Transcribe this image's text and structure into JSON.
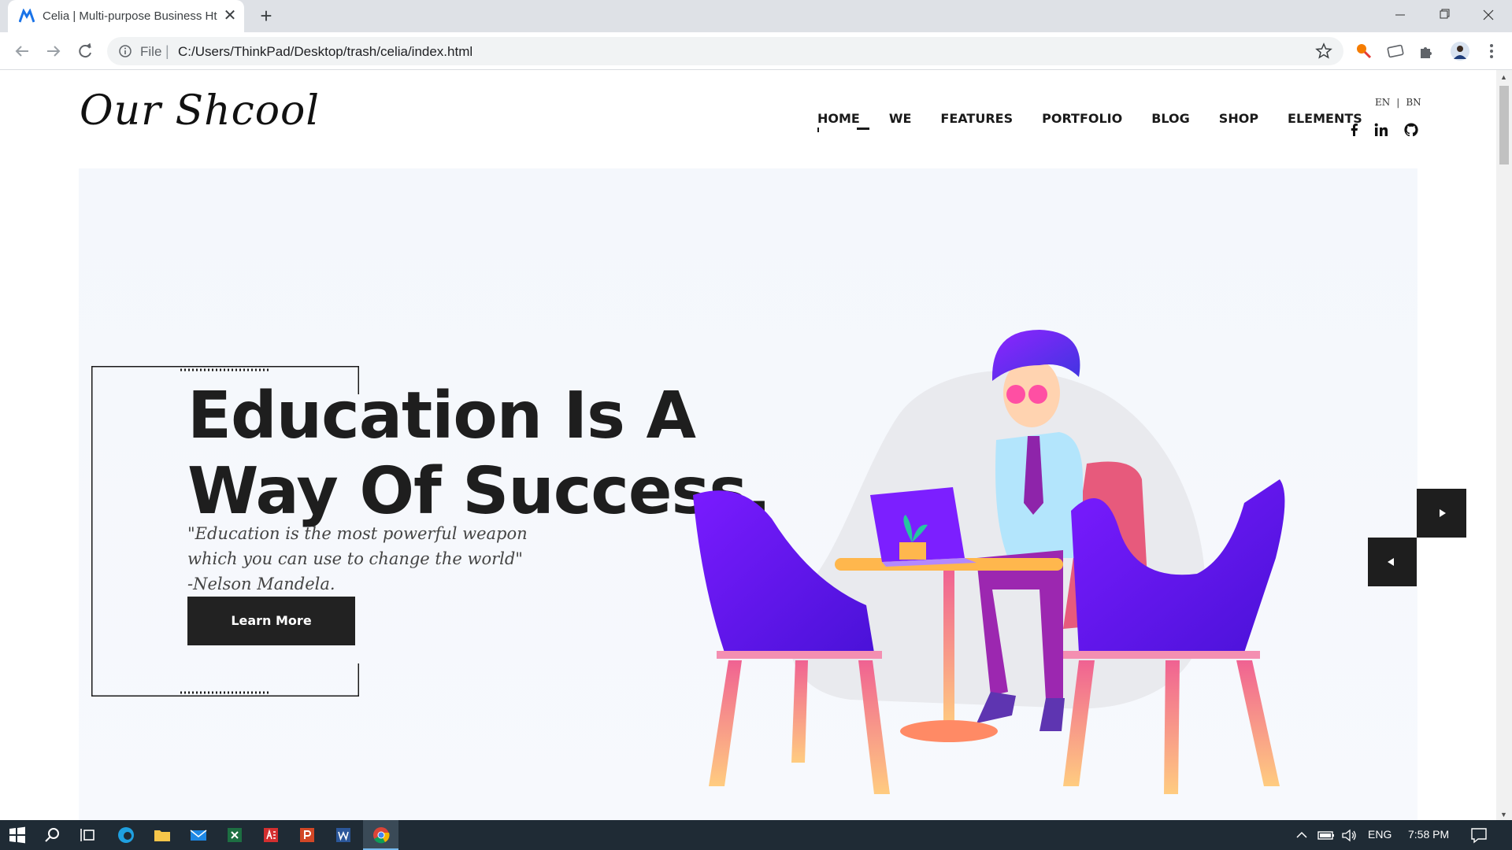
{
  "browser": {
    "tab_title": "Celia | Multi-purpose Business Ht",
    "url_scheme": "File",
    "url": "C:/Users/ThinkPad/Desktop/trash/celia/index.html"
  },
  "site": {
    "logo": "Our Shcool",
    "menu": [
      "HOME",
      "WE",
      "FEATURES",
      "PORTFOLIO",
      "BLOG",
      "SHOP",
      "ELEMENTS"
    ],
    "lang": {
      "en": "EN",
      "sep": "|",
      "bn": "BN"
    },
    "social_icons": [
      "facebook-icon",
      "linkedin-icon",
      "github-icon"
    ]
  },
  "hero": {
    "heading_line1": "Education Is A",
    "heading_line2": "Way Of Success.",
    "quote_line1": "\"Education is the most powerful weapon",
    "quote_line2": "which you can use to change the world\"",
    "quote_line3": "-Nelson Mandela.",
    "button": "Learn More"
  },
  "taskbar": {
    "lang": "ENG",
    "time": "7:58 PM"
  },
  "colors": {
    "accent_purple": "#6a1bff",
    "button_dark": "#222222",
    "hero_bg": "#f4f7fc"
  }
}
